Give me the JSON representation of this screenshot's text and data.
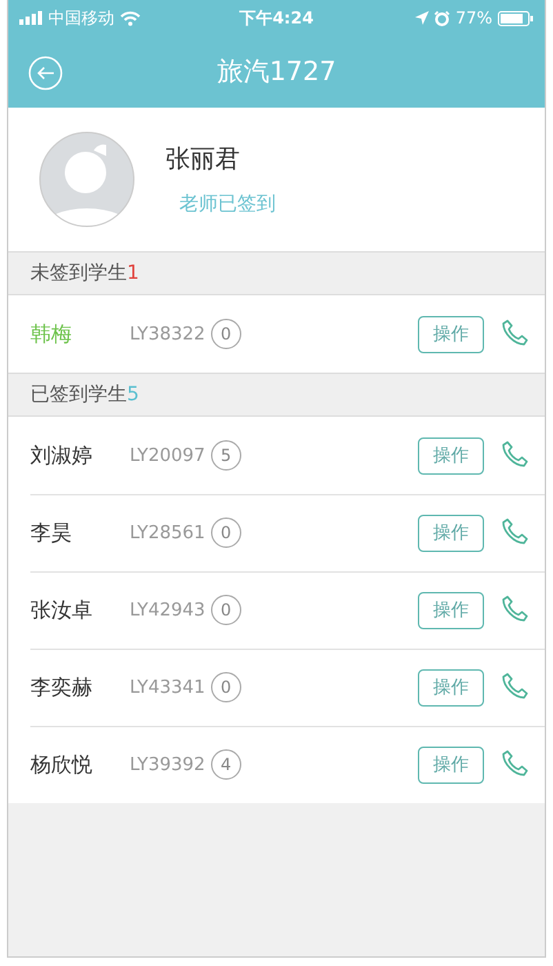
{
  "status_bar": {
    "carrier": "中国移动",
    "time": "下午4:24",
    "battery": "77%"
  },
  "nav": {
    "title": "旅汽1727"
  },
  "teacher": {
    "name": "张丽君",
    "status": "老师已签到"
  },
  "sections": [
    {
      "kind": "unsigned",
      "title": "未签到学生",
      "count": "1",
      "students": [
        {
          "name": "韩梅",
          "id": "LY38322",
          "score": "0",
          "action": "操作"
        }
      ]
    },
    {
      "kind": "signed",
      "title": "已签到学生",
      "count": "5",
      "students": [
        {
          "name": "刘淑婷",
          "id": "LY20097",
          "score": "5",
          "action": "操作"
        },
        {
          "name": "李昊",
          "id": "LY28561",
          "score": "0",
          "action": "操作"
        },
        {
          "name": "张汝卓",
          "id": "LY42943",
          "score": "0",
          "action": "操作"
        },
        {
          "name": "李奕赫",
          "id": "LY43341",
          "score": "0",
          "action": "操作"
        },
        {
          "name": "杨欣悦",
          "id": "LY39392",
          "score": "4",
          "action": "操作"
        }
      ]
    }
  ]
}
